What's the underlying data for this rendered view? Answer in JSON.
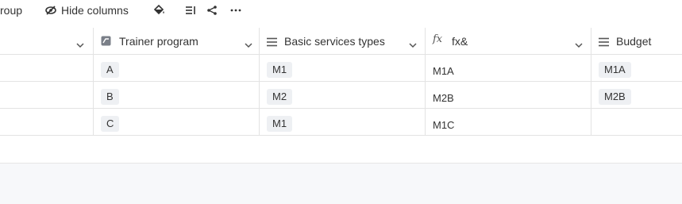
{
  "toolbar": {
    "group_label": "roup",
    "hide_columns_label": "Hide columns",
    "icons": [
      "eye-slash-icon",
      "paint-bucket-icon",
      "row-height-icon",
      "share-icon",
      "more-icon"
    ]
  },
  "columns": [
    {
      "label": "",
      "icon": "none"
    },
    {
      "label": "Trainer program",
      "icon": "single-select-icon"
    },
    {
      "label": "Basic services types",
      "icon": "list-icon"
    },
    {
      "label": "fx&",
      "icon": "formula-icon"
    },
    {
      "label": "Budget",
      "icon": "list-icon"
    }
  ],
  "rows": [
    {
      "trainer": "A",
      "services": "M1",
      "formula": "M1A",
      "budget": "M1A"
    },
    {
      "trainer": "B",
      "services": "M2",
      "formula": "M2B",
      "budget": "M2B"
    },
    {
      "trainer": "C",
      "services": "M1",
      "formula": "M1C",
      "budget": ""
    }
  ],
  "colors": {
    "tag_bg": "#eef0f3",
    "grid_line": "#e3e3e3",
    "footer_bg": "#f7f8fa"
  }
}
